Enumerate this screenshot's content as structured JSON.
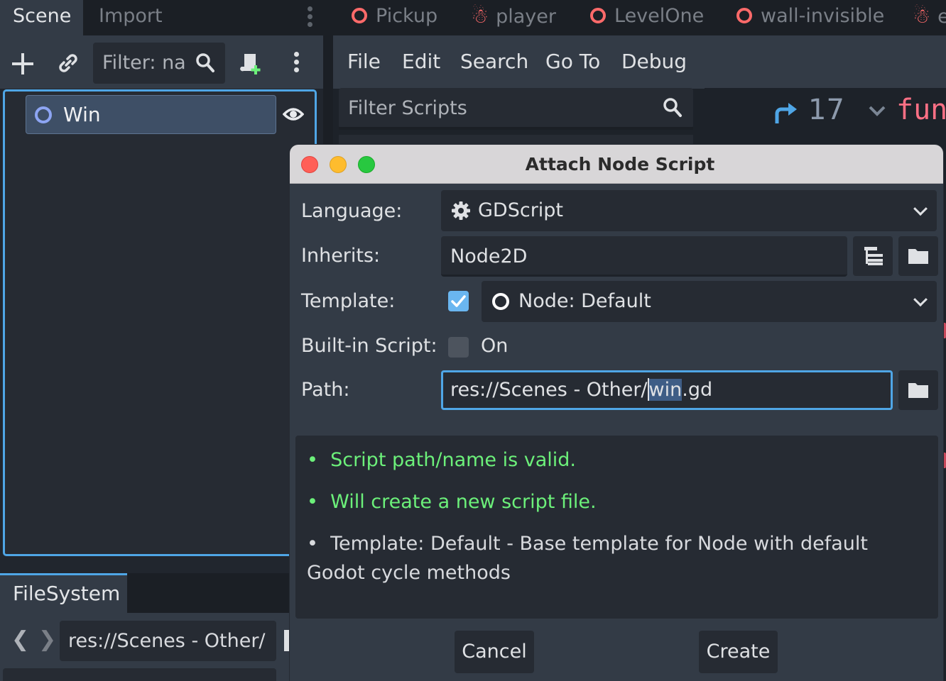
{
  "left_dock": {
    "tabs": [
      {
        "label": "Scene",
        "active": true
      },
      {
        "label": "Import",
        "active": false
      }
    ],
    "filter_placeholder": "Filter: na",
    "tree": [
      {
        "label": "Win",
        "icon": "node-icon"
      }
    ]
  },
  "filesystem": {
    "tab_label": "FileSystem",
    "path": "res://Scenes - Other/"
  },
  "editor": {
    "scene_tabs": [
      "Pickup",
      "player",
      "LevelOne",
      "wall-invisible",
      "e"
    ],
    "menu": [
      "File",
      "Edit",
      "Search",
      "Go To",
      "Debug"
    ],
    "filter_scripts_placeholder": "Filter Scripts",
    "line_number": "17",
    "code_keyword": "fun"
  },
  "dialog": {
    "title": "Attach Node Script",
    "language": {
      "label": "Language:",
      "value": "GDScript"
    },
    "inherits": {
      "label": "Inherits:",
      "value": "Node2D"
    },
    "template": {
      "label": "Template:",
      "checked": true,
      "value": "Node: Default"
    },
    "builtin": {
      "label": "Built-in Script:",
      "checked": false,
      "toggle_label": "On"
    },
    "path": {
      "label": "Path:",
      "prefix": "res://Scenes - Other/",
      "selected": "win",
      "suffix": ".gd"
    },
    "messages": [
      {
        "text": "Script path/name is valid.",
        "kind": "ok"
      },
      {
        "text": "Will create a new script file.",
        "kind": "ok"
      },
      {
        "text": "Template: Default - Base template for Node with default Godot cycle methods",
        "kind": "info"
      }
    ],
    "buttons": {
      "cancel": "Cancel",
      "create": "Create"
    }
  },
  "colors": {
    "accent": "#4fa6e6",
    "ok_text": "#6cf07a",
    "scene_tab_icon": "#ff6a6a",
    "node_icon": "#8da5f3",
    "checkbox": "#6ab6f0"
  }
}
